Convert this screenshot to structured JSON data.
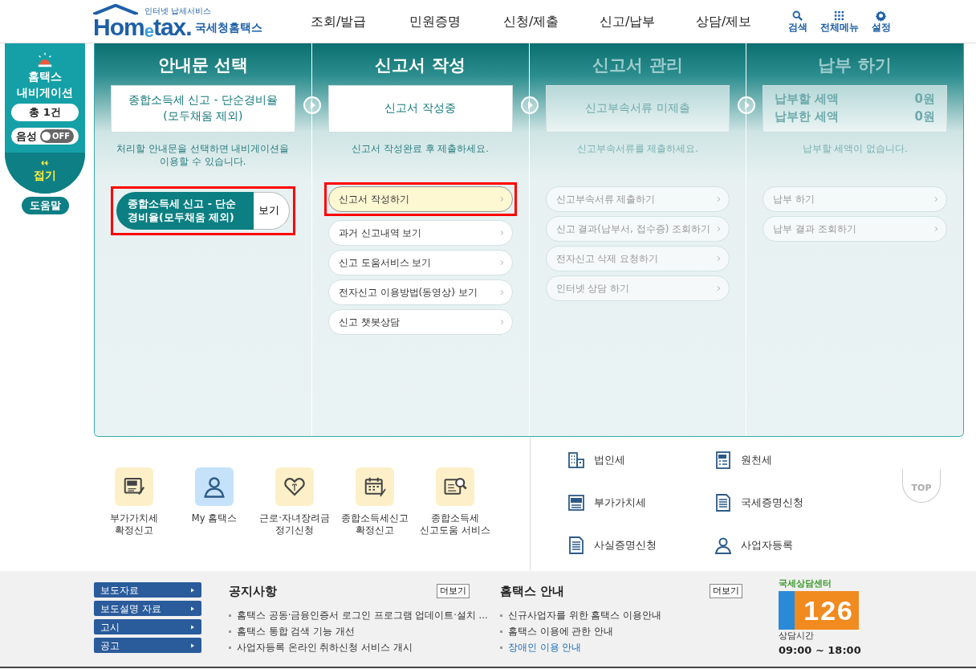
{
  "header": {
    "logo_small": "인터넷 납세서비스",
    "logo_main": "Hom$_{e}$tax.",
    "logo_sub": "국세청홈택스",
    "menu": [
      "조회/발급",
      "민원증명",
      "신청/제출",
      "신고/납부",
      "상담/제보"
    ],
    "tools": [
      {
        "label": "검색"
      },
      {
        "label": "전체메뉴"
      },
      {
        "label": "설정"
      }
    ]
  },
  "navigator": {
    "title": "홈택스 내비게이션",
    "count": "총 1건",
    "voice_label": "음성",
    "voice_on": false,
    "voice_state": "OFF",
    "collapse": "접기",
    "help": "도움말"
  },
  "stages": [
    {
      "title": "안내문 선택",
      "active": true,
      "status": {
        "kind": "text",
        "text": "종합소득세 신고 - 단순경비율 (모두채움 제외)"
      },
      "note": "처리할 안내문을 선택하면 내비게이션을 이용할 수 있습니다.",
      "document": {
        "title": "종합소득세 신고 - 단순경비율(모두채움 제외)",
        "action": "보기",
        "highlighted": true
      }
    },
    {
      "title": "신고서 작성",
      "active": true,
      "status": {
        "kind": "text",
        "text": "신고서 작성중"
      },
      "note": "신고서 작성완료 후 제출하세요.",
      "items": [
        {
          "label": "신고서 작성하기",
          "selected": true
        },
        {
          "label": "과거 신고내역 보기",
          "selected": false
        },
        {
          "label": "신고 도움서비스 보기",
          "selected": false
        },
        {
          "label": "전자신고 이용방법(동영상) 보기",
          "selected": false
        },
        {
          "label": "신고 챗봇상담",
          "selected": false
        }
      ]
    },
    {
      "title": "신고서 관리",
      "active": false,
      "status": {
        "kind": "text",
        "text": "신고부속서류 미제출"
      },
      "note": "신고부속서류를 제출하세요.",
      "items": [
        {
          "label": "신고부속서류 제출하기",
          "selected": false
        },
        {
          "label": "신고 결과(납부서, 접수증) 조회하기",
          "selected": false
        },
        {
          "label": "전자신고 삭제 요청하기",
          "selected": false
        },
        {
          "label": "인터넷 상담 하기",
          "selected": false
        }
      ]
    },
    {
      "title": "납부 하기",
      "active": false,
      "status": {
        "kind": "amounts",
        "rows": [
          {
            "label": "납부할 세액",
            "value": "0원"
          },
          {
            "label": "납부한 세액",
            "value": "0원"
          }
        ]
      },
      "note": "납부할 세액이 없습니다.",
      "items": [
        {
          "label": "납부 하기",
          "selected": false
        },
        {
          "label": "납부 결과 조회하기",
          "selected": false
        }
      ]
    }
  ],
  "quick_links": [
    {
      "lines": [
        "부가가치세",
        "확정신고"
      ],
      "color": "#fdf0c8"
    },
    {
      "lines": [
        "My 홈택스"
      ],
      "color": "#c6e2fa"
    },
    {
      "lines": [
        "근로·자녀장려금",
        "정기신청"
      ],
      "color": "#fdf0c8"
    },
    {
      "lines": [
        "종합소득세신고",
        "확정신고"
      ],
      "color": "#fdf0c8"
    },
    {
      "lines": [
        "종합소득세",
        "신고도움 서비스"
      ],
      "color": "#fdf0c8"
    }
  ],
  "services": [
    {
      "label": "법인세"
    },
    {
      "label": "원천세"
    },
    {
      "label": "부가가치세"
    },
    {
      "label": "국세증명신청"
    },
    {
      "label": "사실증명신청"
    },
    {
      "label": "사업자등록"
    }
  ],
  "top_button": "TOP",
  "footer": {
    "categories": [
      "보도자료",
      "보도설명 자료",
      "고시",
      "공고"
    ],
    "boards": [
      {
        "title": "공지사항",
        "more": "더보기",
        "items": [
          {
            "text": "홈택스 공동·금융인증서 로그인 프로그램 업데이트·설치 ...",
            "kind": "plain"
          },
          {
            "text": "홈택스 통합 검색 기능 개선",
            "kind": "plain"
          },
          {
            "text": "사업자등록 온라인 취하신청 서비스 개시",
            "kind": "plain"
          }
        ]
      },
      {
        "title": "홈택스 안내",
        "more": "더보기",
        "items": [
          {
            "text": "신규사업자를 위한 홈택스 이용안내",
            "kind": "plain"
          },
          {
            "text": "홈택스 이용에 관한 안내",
            "kind": "plain"
          },
          {
            "text": "장애인 이용 안내",
            "kind": "link"
          }
        ]
      }
    ],
    "call_center": {
      "label": "국세상담센터",
      "number": "126",
      "hours_label": "상담시간",
      "hours": "09:00 ~ 18:00"
    }
  }
}
